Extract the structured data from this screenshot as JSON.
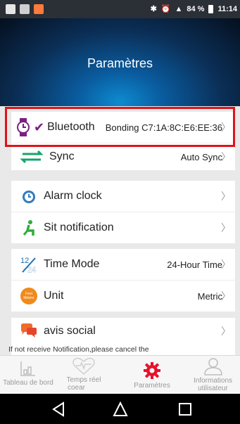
{
  "status_bar": {
    "battery": "84 %",
    "time": "11:14",
    "colors": {
      "app1": "#ff7a3b",
      "app2": "#dcdcdc"
    }
  },
  "header": {
    "title": "Paramètres"
  },
  "settings": {
    "bluetooth": {
      "label": "Bluetooth",
      "value": "Bonding C7:1A:8C:E6:EE:36"
    },
    "sync": {
      "label": "Sync",
      "value": "Auto Sync"
    },
    "alarm": {
      "label": "Alarm clock"
    },
    "sit": {
      "label": "Sit notification"
    },
    "time_mode": {
      "label": "Time Mode",
      "value": "24-Hour Time",
      "icon_text_top": "12",
      "icon_text_bottom": "24"
    },
    "unit": {
      "label": "Unit",
      "value": "Metric",
      "icon_text_top": "Feet",
      "icon_text_bottom": "Meters"
    },
    "social": {
      "label": "avis social"
    },
    "note": "If not receive Notification,please cancel the"
  },
  "tabs": [
    {
      "label_line1": "Tableau de bord",
      "label_line2": ""
    },
    {
      "label_line1": "Temps réel",
      "label_line2": "coear"
    },
    {
      "label_line1": "Paramètres",
      "label_line2": ""
    },
    {
      "label_line1": "Informations",
      "label_line2": "utilisateur"
    }
  ],
  "colors": {
    "accent": "#e8112a",
    "purple": "#7b1f82",
    "green": "#16a36a"
  }
}
